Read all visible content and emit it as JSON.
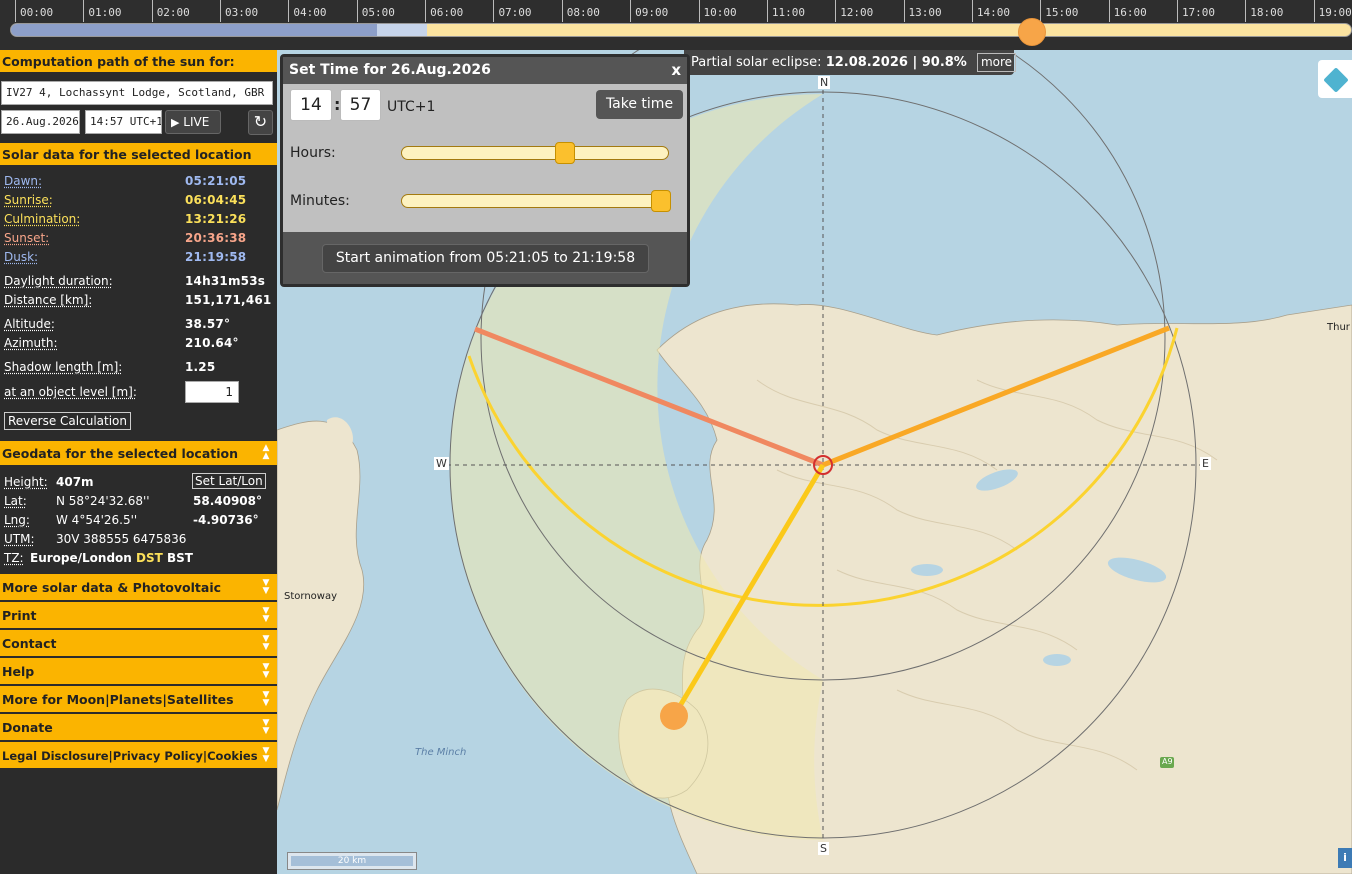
{
  "timeline": {
    "hours": [
      "00:00",
      "01:00",
      "02:00",
      "03:00",
      "04:00",
      "05:00",
      "06:00",
      "07:00",
      "08:00",
      "09:00",
      "10:00",
      "11:00",
      "12:00",
      "13:00",
      "14:00",
      "15:00",
      "16:00",
      "17:00",
      "18:00",
      "19:00"
    ],
    "current_time_fraction_of_day": 0.6229,
    "colors": {
      "night": "#8d9fc9",
      "twilight": "#c6d4ea",
      "day": "#fbe3a0",
      "sun": "#f7a548"
    }
  },
  "sidebar": {
    "computation_header": "Computation path of the sun for:",
    "location": "IV27 4, Lochassynt Lodge, Scotland, GBR",
    "date": "26.Aug.2026",
    "time": "14:57 UTC+1",
    "live_label": "LIVE",
    "solar_header": "Solar data for the selected location",
    "solar_rows": [
      {
        "label": "Dawn:",
        "value": "05:21:05",
        "color": "#9fb9f0"
      },
      {
        "label": "Sunrise:",
        "value": "06:04:45",
        "color": "#fbe05a"
      },
      {
        "label": "Culmination:",
        "value": "13:21:26",
        "color": "#fbe05a"
      },
      {
        "label": "Sunset:",
        "value": "20:36:38",
        "color": "#f7a58a"
      },
      {
        "label": "Dusk:",
        "value": "21:19:58",
        "color": "#9fb9f0"
      }
    ],
    "daylight_label": "Daylight duration:",
    "daylight_value": "14h31m53s",
    "distance_label": "Distance [km]:",
    "distance_value": "151,171,461",
    "altitude_label": "Altitude:",
    "altitude_value": "38.57°",
    "azimuth_label": "Azimuth:",
    "azimuth_value": "210.64°",
    "shadow_label": "Shadow length [m]:",
    "shadow_value": "1.25",
    "object_level_label": "at an object level [m]:",
    "object_level_value": "1",
    "reverse_button": "Reverse Calculation",
    "geo_header": "Geodata for the selected location",
    "height_label": "Height:",
    "height_value": "407m",
    "set_latlon": "Set Lat/Lon",
    "lat_label": "Lat:",
    "lat_dms": "N 58°24'32.68''",
    "lat_dec": "58.40908°",
    "lng_label": "Lng:",
    "lng_dms": "W 4°54'26.5''",
    "lng_dec": "-4.90736°",
    "utm_label": "UTM:",
    "utm_value": "30V 388555 6475836",
    "tz_label": "TZ:",
    "tz_value": "Europe/London",
    "tz_dst": "DST",
    "tz_bst": "BST",
    "collapsed_sections": [
      "More solar data & Photovoltaic",
      "Print",
      "Contact",
      "Help",
      "More for Moon|Planets|Satellites",
      "Donate",
      "Legal Disclosure|Privacy Policy|Cookies"
    ]
  },
  "popup": {
    "title": "Set Time for 26.Aug.2026",
    "close": "x",
    "hour": "14",
    "colon": ":",
    "minute": "57",
    "tz": "UTC+1",
    "take_time": "Take time",
    "hours_label": "Hours:",
    "minutes_label": "Minutes:",
    "hours_slider_fraction": 0.6087,
    "minutes_slider_fraction": 0.966,
    "animation_button": "Start animation from 05:21:05 to 21:19:58"
  },
  "eclipse": {
    "label": "Partial solar eclipse:",
    "value": "12.08.2026 | 90.8%",
    "more": "more"
  },
  "map": {
    "compass": {
      "n": "N",
      "s": "S",
      "e": "E",
      "w": "W"
    },
    "places": {
      "stornoway": "Stornoway",
      "the_minch": "The Minch",
      "thurso": "Thur",
      "road": "A9"
    },
    "scale": "20 km",
    "info": "i",
    "colors": {
      "sunrise_line": "#f9a825",
      "sunset_line": "#f08860",
      "sun_direction": "#fbc91a",
      "sun": "#f7a548"
    }
  }
}
